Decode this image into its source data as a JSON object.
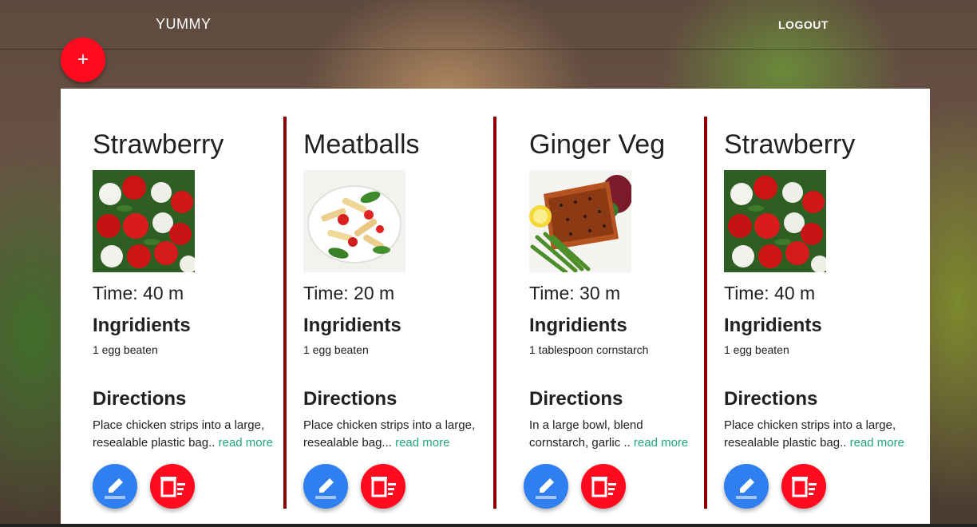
{
  "nav": {
    "brand": "YUMMY",
    "logout": "LOGOUT",
    "add_button": "+"
  },
  "recipe_labels": {
    "ingredients_heading": "Ingridients",
    "directions_heading": "Directions",
    "read_more": "read more"
  },
  "recipes": [
    {
      "title": "Strawberry",
      "time": "Time: 40 m",
      "ingredients": "1 egg beaten",
      "directions": "Place chicken strips into a large, resealable plastic bag..",
      "image": "tomato-mozzarella-salad"
    },
    {
      "title": "Meatballs",
      "time": "Time: 20 m",
      "ingredients": "1 egg beaten",
      "directions": "Place chicken strips into a large, resealable bag...",
      "image": "penne-pasta-plate"
    },
    {
      "title": "Ginger Veg",
      "time": "Time: 30 m",
      "ingredients": "1 tablespoon cornstarch",
      "directions": "In a large bowl, blend cornstarch, garlic ..",
      "image": "salmon-asparagus-plate"
    },
    {
      "title": "Strawberry",
      "time": "Time: 40 m",
      "ingredients": "1 egg beaten",
      "directions": "Place chicken strips into a large, resealable plastic bag..",
      "image": "tomato-mozzarella-salad"
    }
  ],
  "colors": {
    "accent_red": "#ff0a1e",
    "edit_blue": "#2f7ff0",
    "divider": "#8b0000",
    "link_green": "#1fa67a"
  },
  "icons": {
    "edit": "pencil-icon",
    "delete": "trash-list-icon"
  }
}
